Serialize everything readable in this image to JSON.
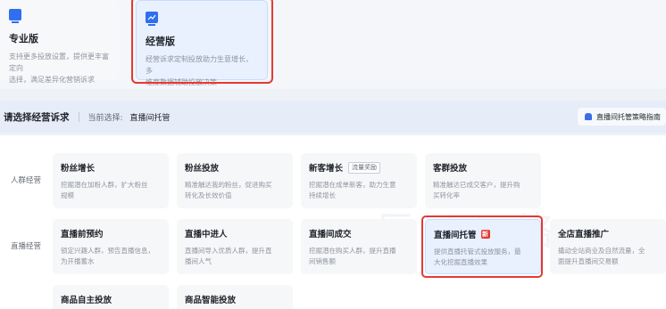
{
  "editions": {
    "pro": {
      "icon": "edition-icon",
      "title": "专业版",
      "desc_line1": "支持更多投放设置，提供更丰富定向",
      "desc_line2": "选择，满足差异化营销诉求"
    },
    "biz": {
      "icon": "chart-monitor-icon",
      "title": "经营版",
      "desc_line1": "经营诉求定制投放助力生意增长，多",
      "desc_line2": "维度数据辅助投放决策"
    }
  },
  "goal": {
    "title": "请选择经营诉求",
    "current_label": "当前选择:",
    "current_value": "直播间托管",
    "guide_label": "直播间托管策略指南"
  },
  "rows": {
    "crowd": {
      "label": "人群经营",
      "cards": [
        {
          "title": "粉丝增长",
          "desc1": "挖掘潜在加粉人群，扩大粉丝",
          "desc2": "规模"
        },
        {
          "title": "粉丝投放",
          "desc1": "精准触达我的粉丝，促进购买",
          "desc2": "转化及长效价值"
        },
        {
          "title": "新客增长",
          "tag": "流量奖励",
          "desc1": "挖掘潜在成单新客，助力生意",
          "desc2": "持续增长"
        },
        {
          "title": "客群投放",
          "desc1": "精准触达已成交客户，提升购",
          "desc2": "买转化率"
        }
      ]
    },
    "live": {
      "label": "直播经营",
      "cards": [
        {
          "title": "直播前预约",
          "desc1": "锁定兴趣人群，预告直播信息，",
          "desc2": "为开播蓄水"
        },
        {
          "title": "直播中进人",
          "desc1": "直播间导入优质人群，提升直",
          "desc2": "播间人气"
        },
        {
          "title": "直播间成交",
          "desc1": "挖掘潜在购买人群，提升直播",
          "desc2": "间销售额"
        },
        {
          "title": "直播间托管",
          "badge": "新",
          "desc1": "提供直播托管式投放服务，最",
          "desc2": "大化挖掘直播效果"
        },
        {
          "title": "全店直播推广",
          "desc1": "撬动全站商业及自然流量，全",
          "desc2": "面提升直播间交易额"
        }
      ]
    },
    "product": {
      "cards": [
        {
          "title": "商品自主投放"
        },
        {
          "title": "商品智能投放"
        }
      ]
    }
  },
  "colors": {
    "accent": "#2f6ff0",
    "highlight_border": "#e53935",
    "selected_bg": "#e9f1ff"
  }
}
